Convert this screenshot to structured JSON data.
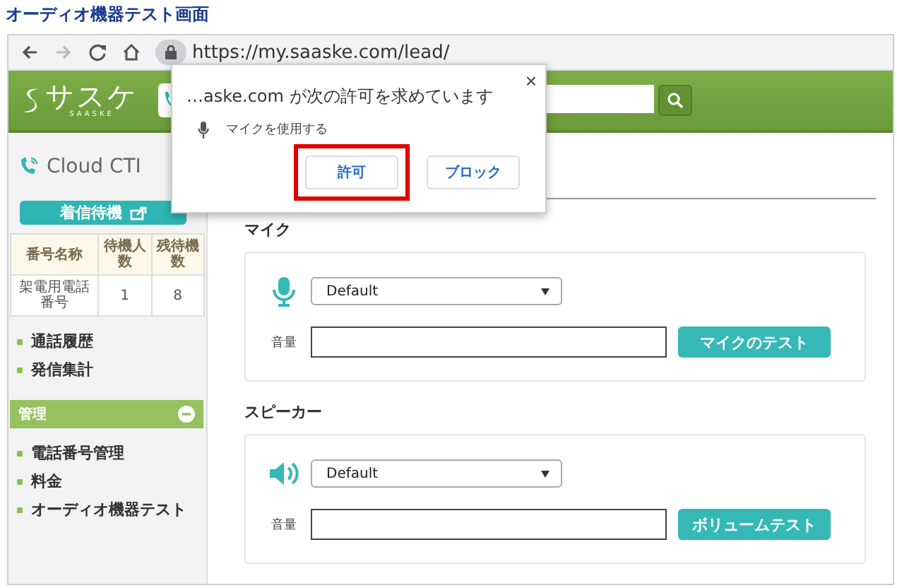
{
  "caption": "オーディオ機器テスト画面",
  "browser": {
    "url": "https://my.saaske.com/lead/",
    "forward_disabled": true
  },
  "header": {
    "logo": "サスケ",
    "logo_sub": "SAASKE"
  },
  "popup": {
    "title": "…aske.com が次の許可を求めています",
    "permission": "マイクを使用する",
    "close": "×",
    "buttons": [
      {
        "label": "許可",
        "highlighted": true
      },
      {
        "label": "ブロック",
        "highlighted": false
      }
    ]
  },
  "sidebar": {
    "title": "Cloud CTI",
    "status_button": "着信待機",
    "table": {
      "columns": [
        "番号名称",
        "待機人数",
        "残待機数"
      ],
      "rows": [
        [
          "架電用電話番号",
          "1",
          "8"
        ]
      ]
    },
    "links": [
      "通話履歴",
      "発信集計"
    ],
    "sections": [
      {
        "title": "管理",
        "expanded": true,
        "links": [
          "電話番号管理",
          "料金",
          "オーディオ機器テスト"
        ]
      }
    ]
  },
  "main": {
    "sections": [
      {
        "kind": "mic",
        "heading": "マイク",
        "device": "Default",
        "volume_label": "音量",
        "test_button": "マイクのテスト"
      },
      {
        "kind": "speaker",
        "heading": "スピーカー",
        "device": "Default",
        "volume_label": "音量",
        "test_button": "ボリュームテスト"
      }
    ]
  }
}
